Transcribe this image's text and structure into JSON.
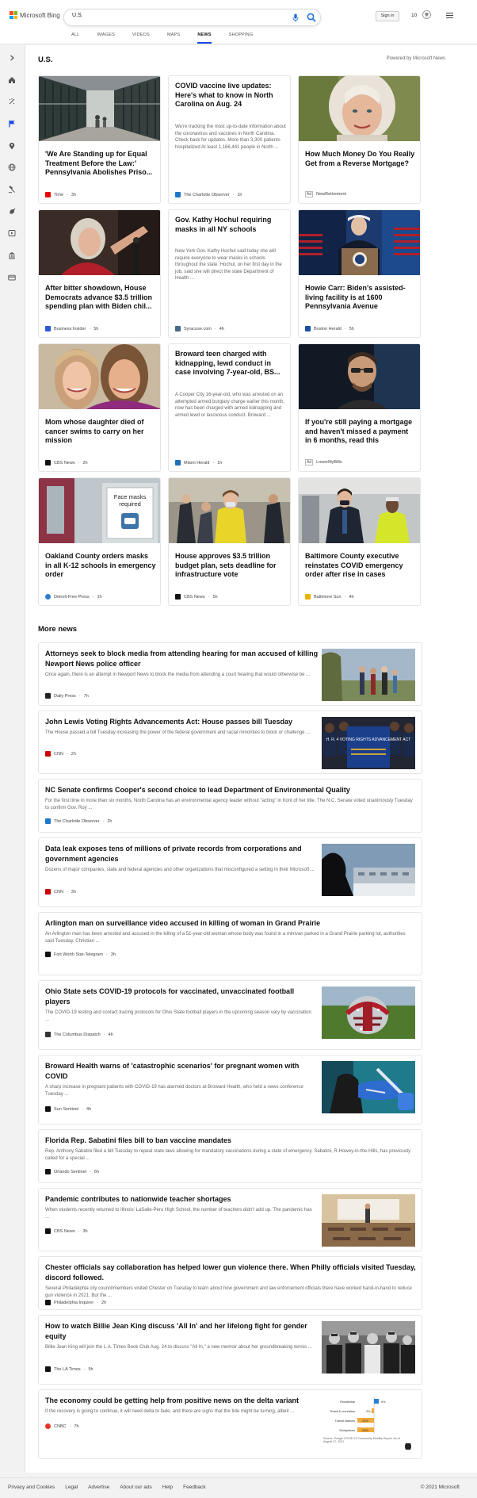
{
  "header": {
    "brand": "Microsoft Bing",
    "search_value": "U.S.",
    "signin_label": "Sign in",
    "rewards_count": "10",
    "tabs": [
      {
        "label": "ALL"
      },
      {
        "label": "IMAGES"
      },
      {
        "label": "VIDEOS"
      },
      {
        "label": "MAPS"
      },
      {
        "label": "NEWS"
      },
      {
        "label": "SHOPPING"
      }
    ]
  },
  "page": {
    "title": "U.S.",
    "powered_by": "Powered by Microsoft News"
  },
  "cards": [
    {
      "title": "'We Are Standing up for Equal Treatment Before the Law:' Pennsylvania Abolishes Priso...",
      "source": "Time",
      "time": "3h",
      "icon": "time-logo-icon",
      "color": "#e90606"
    },
    {
      "title": "COVID vaccine live updates: Here's what to know in North Carolina on Aug. 24",
      "desc": "We're tracking the most up-to-date information about the coronavirus and vaccines in North Carolina. Check back for updates. More than 3,300 patients hospitalized At least 1,166,441 people in North ...",
      "source": "The Charlotte Observer",
      "time": "1h",
      "icon": "charlotte-observer-logo-icon",
      "color": "#1e78c8"
    },
    {
      "title": "How Much Money Do You Really Get from a Reverse Mortgage?",
      "ad": "Ad",
      "source": "NewRetirement",
      "icon": "ad-badge"
    },
    {
      "title": "After bitter showdown, House Democrats advance $3.5 trillion spending plan with Biden chil...",
      "source": "Business Insider",
      "time": "5h",
      "icon": "business-insider-logo-icon",
      "color": "#2b5bd7"
    },
    {
      "title": "Gov. Kathy Hochul requiring masks in all NY schools",
      "desc": "New York Gov. Kathy Hochul said today she will require everyone to wear masks in schools throughout the state. Hochul, on her first day in the job, said she will direct the state Department of Health ...",
      "source": "Syracuse.com",
      "time": "4h",
      "icon": "syracuse-logo-icon",
      "color": "#4a6a8a"
    },
    {
      "title": "Howie Carr: Biden's assisted-living facility is at 1600 Pennsylvania Avenue",
      "source": "Boston Herald",
      "time": "5h",
      "icon": "boston-herald-logo-icon",
      "color": "#1b4fa0"
    },
    {
      "title": "Mom whose daughter died of cancer swims to carry on her mission",
      "source": "CBS News",
      "time": "2h",
      "icon": "cbs-news-logo-icon",
      "color": "#111111"
    },
    {
      "title": "Broward teen charged with kidnapping, lewd conduct in case involving 7-year-old, BS...",
      "desc": "A Cooper City 16-year-old, who was arrested on an attempted armed burglary charge earlier this month, now has been charged with armed kidnapping and armed lewd or lascivious conduct. Broward ...",
      "source": "Miami Herald",
      "time": "1h",
      "icon": "miami-herald-logo-icon",
      "color": "#1d6fb8"
    },
    {
      "title": "If you're still paying a mortgage and haven't missed a payment in 6 months, read this",
      "ad": "Ad",
      "source": "LowerMyBills",
      "icon": "ad-badge"
    },
    {
      "title": "Oakland County orders masks in all K-12 schools in emergency order",
      "source": "Detroit Free Press",
      "time": "1h",
      "icon": "detroit-free-press-logo-icon",
      "color": "#2f7bd0"
    },
    {
      "title": "House approves $3.5 trillion budget plan, sets deadline for infrastructure vote",
      "source": "CBS News",
      "time": "5h",
      "icon": "cbs-news-logo-icon",
      "color": "#111111"
    },
    {
      "title": "Baltimore County executive reinstates COVID emergency order after rise in cases",
      "source": "Baltimore Sun",
      "time": "4h",
      "icon": "baltimore-sun-logo-icon",
      "color": "#e8b400"
    }
  ],
  "more_news": {
    "title": "More news",
    "items": [
      {
        "title": "Attorneys seek to block media from attending hearing for man accused of killing Newport News police officer",
        "desc": "Once again, there is an attempt in Newport News to block the media from attending a court hearing that would otherwise be ...",
        "source": "Daily Press",
        "time": "7h",
        "icon": "daily-press-logo-icon",
        "color": "#222222"
      },
      {
        "title": "John Lewis Voting Rights Advancements Act: House passes bill Tuesday",
        "desc": "The House passed a bill Tuesday increasing the power of the federal government and racial minorities to block or challenge ...",
        "source": "CNN",
        "time": "2h",
        "icon": "cnn-logo-icon",
        "color": "#cc0000",
        "img_text": "H. R. 4 VOTING RIGHTS ADVANCEMENT ACT"
      },
      {
        "title": "NC Senate confirms Cooper's second choice to lead Department of Environmental Quality",
        "desc": "For the first time in more than six months, North Carolina has an environmental agency leader without \"acting\" in front of her title. The N.C. Senate voted unanimously Tuesday to confirm Gov. Roy ...",
        "source": "The Charlotte Observer",
        "time": "2h",
        "icon": "charlotte-observer-logo-icon",
        "color": "#1e78c8"
      },
      {
        "title": "Data leak exposes tens of millions of private records from corporations and government agencies",
        "desc": "Dozens of major companies, state and federal agencies and other organizations that misconfigured a setting in their Microsoft ...",
        "source": "CNN",
        "time": "3h",
        "icon": "cnn-logo-icon",
        "color": "#cc0000"
      },
      {
        "title": "Arlington man on surveillance video accused in killing of woman in Grand Prairie",
        "desc": "An Arlington man has been arrested and accused in the killing of a 51-year-old woman whose body was found in a minivan parked in a Grand Prairie parking lot, authorities said Tuesday. Christian ...",
        "source": "Fort Worth Star-Telegram",
        "time": "3h",
        "icon": "star-telegram-logo-icon",
        "color": "#111111"
      },
      {
        "title": "Ohio State sets COVID-19 protocols for vaccinated, unvaccinated football players",
        "desc": "The COVID-19 testing and contact tracing protocols for Ohio State football players in the upcoming season vary by vaccination ...",
        "source": "The Columbus Dispatch",
        "time": "4h",
        "icon": "columbus-dispatch-logo-icon",
        "color": "#333333"
      },
      {
        "title": "Broward Health warns of 'catastrophic scenarios' for pregnant women with COVID",
        "desc": "A sharp increase in pregnant patients with COVID-19 has alarmed doctors at Broward Health, who held a news conference Tuesday ...",
        "source": "Sun Sentinel",
        "time": "4h",
        "icon": "sun-sentinel-logo-icon",
        "color": "#111111"
      },
      {
        "title": "Florida Rep. Sabatini files bill to ban vaccine mandates",
        "desc": "Rep. Anthony Sabatini filed a bill Tuesday to repeal state laws allowing for mandatory vaccinations during a state of emergency. Sabatini, R-Howey-in-the-Hills, has previously called for a special ...",
        "source": "Orlando Sentinel",
        "time": "6h",
        "icon": "orlando-sentinel-logo-icon",
        "color": "#111111"
      },
      {
        "title": "Pandemic contributes to nationwide teacher shortages",
        "desc": "When students recently returned to Illinois' LaSalle-Peru High School, the number of teachers didn't add up. The pandemic has ...",
        "source": "CBS News",
        "time": "3h",
        "icon": "cbs-news-logo-icon",
        "color": "#111111"
      },
      {
        "title": "Chester officials say collaboration has helped lower gun violence there. When Philly officials visited Tuesday, discord followed.",
        "desc": "Several Philadelphia city councilmembers visited Chester on Tuesday to learn about how government and law enforcement officials there have worked hand-in-hand to reduce gun violence in 2021. But the ...",
        "source": "Philadelphia Inquirer",
        "time": "2h",
        "icon": "inquirer-logo-icon",
        "color": "#111111"
      },
      {
        "title": "How to watch Billie Jean King discuss 'All In' and her lifelong fight for gender equity",
        "desc": "Billie Jean King will join the L.A. Times Book Club Aug. 24 to discuss \"All In,\" a new memoir about her groundbreaking tennis ...",
        "source": "The LA Times",
        "time": "5h",
        "icon": "la-times-logo-icon",
        "color": "#111111"
      },
      {
        "title": "The economy could be getting help from positive news on the delta variant",
        "desc": "If the recovery is going to continue, it will need delta to fade, and there are signs that the tide might be turning, albeit ...",
        "source": "CNBC",
        "time": "7h",
        "icon": "cnbc-logo-icon",
        "color": "#e8362b",
        "mini_chart": {
          "rows": [
            {
              "label": "Residential",
              "value": "6%"
            },
            {
              "label": "Retail & recreation",
              "value": "-3%"
            },
            {
              "label": "Transit stations",
              "value": "-33%"
            },
            {
              "label": "Workplaces",
              "value": "-33%"
            }
          ],
          "source_note": "Source: Google COVID-19 Community Mobility Report. As of August 17, 2021"
        }
      }
    ]
  },
  "footer": {
    "links": [
      {
        "label": "Privacy and Cookies"
      },
      {
        "label": "Legal"
      },
      {
        "label": "Advertise"
      },
      {
        "label": "About our ads"
      },
      {
        "label": "Help"
      },
      {
        "label": "Feedback"
      }
    ],
    "copyright": "© 2021 Microsoft"
  },
  "colors": {
    "accent": "#174ae4",
    "bing_blue": "#1a6fd6"
  }
}
